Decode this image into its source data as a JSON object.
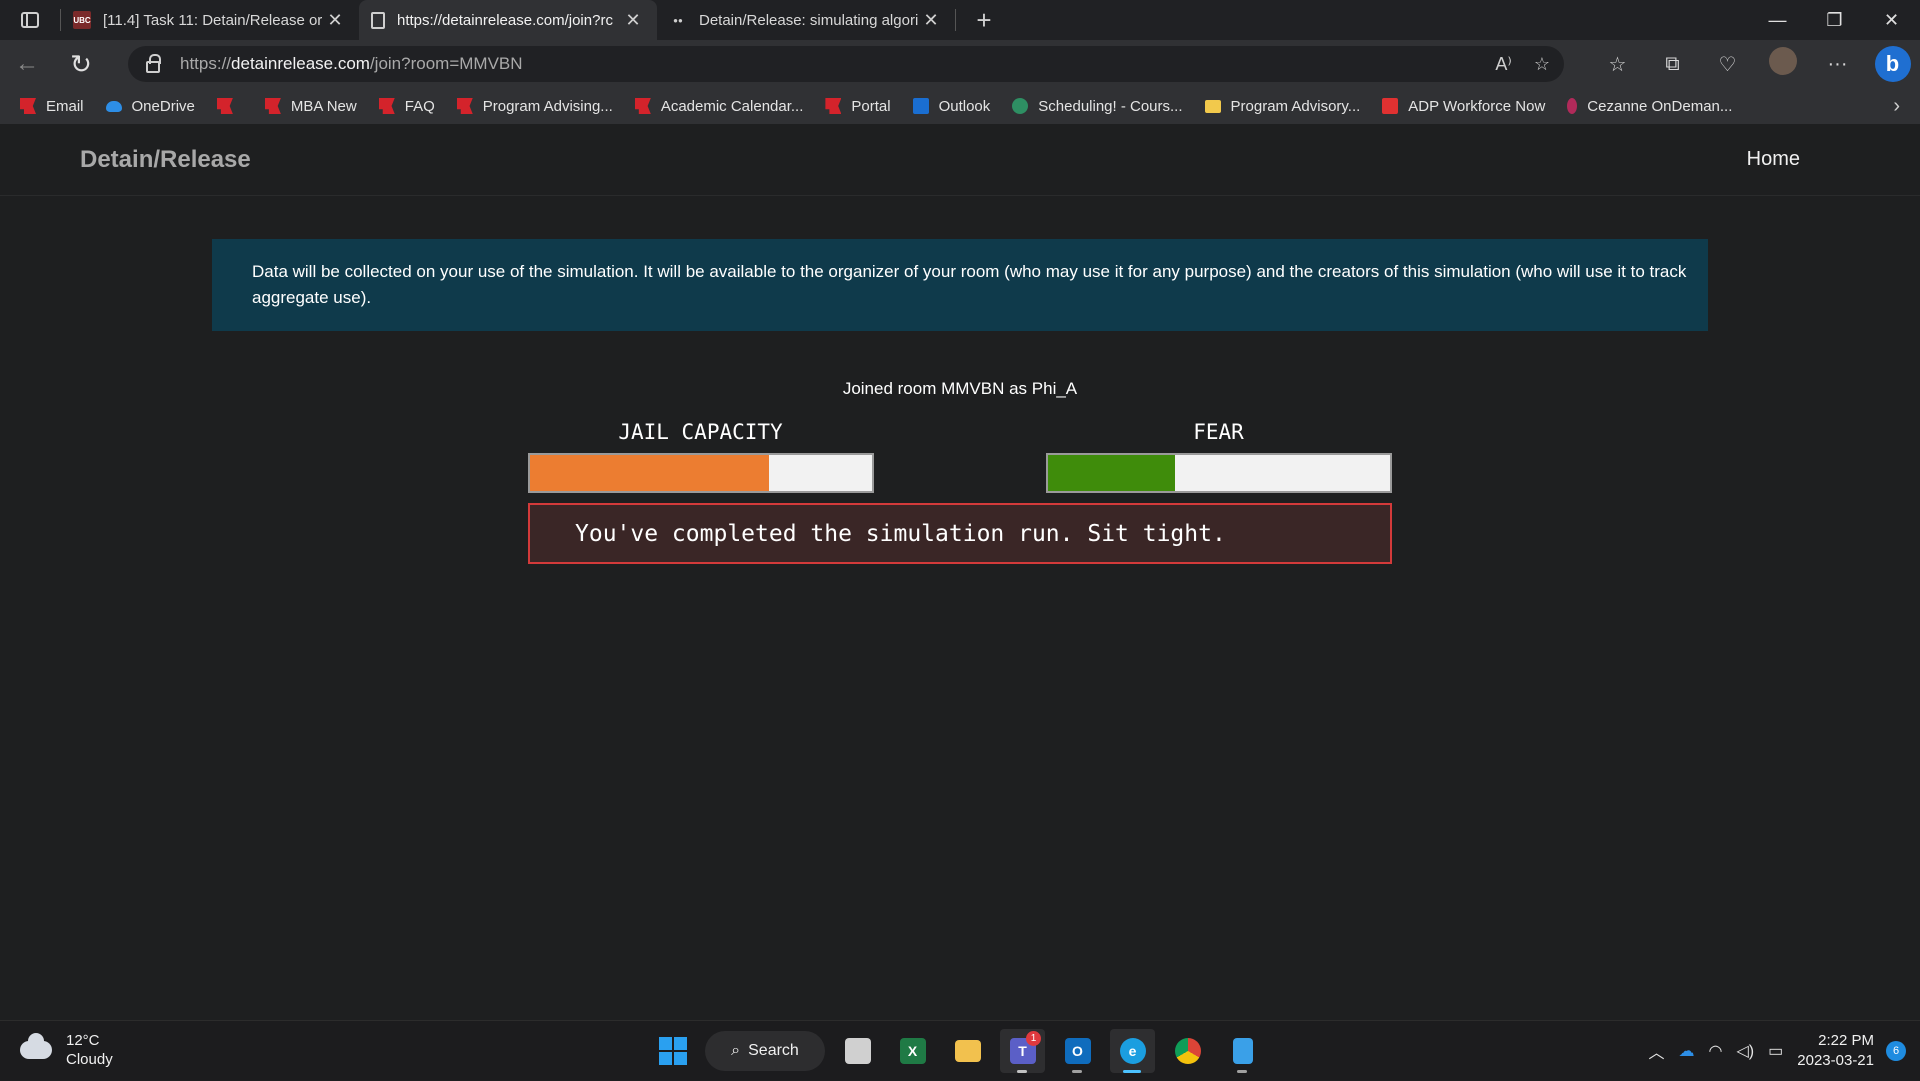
{
  "browser": {
    "tabs": [
      {
        "favicon": "UBC",
        "title": "[11.4] Task 11: Detain/Release or",
        "icon": "ubc-favicon-icon"
      },
      {
        "title": "https://detainrelease.com/join?rc",
        "icon": "page-icon"
      },
      {
        "title": "Detain/Release: simulating algori",
        "icon": "media-dots-icon"
      }
    ],
    "url_prefix": "https://",
    "url_domain": "detainrelease.com",
    "url_path": "/join?room=MMVBN",
    "read_aloud_label": "A⁾",
    "favorites": [
      {
        "label": "Email",
        "icon": "red-flag-icon"
      },
      {
        "label": "OneDrive",
        "icon": "onedrive-icon"
      },
      {
        "label": "",
        "icon": "red-flag-icon"
      },
      {
        "label": "MBA New",
        "icon": "red-flag-icon"
      },
      {
        "label": "FAQ",
        "icon": "red-flag-icon"
      },
      {
        "label": "Program Advising...",
        "icon": "red-flag-icon"
      },
      {
        "label": "Academic Calendar...",
        "icon": "red-flag-icon"
      },
      {
        "label": "Portal",
        "icon": "red-flag-icon"
      },
      {
        "label": "Outlook",
        "icon": "outlook-icon"
      },
      {
        "label": "Scheduling! - Cours...",
        "icon": "sharepoint-icon"
      },
      {
        "label": "Program Advisory...",
        "icon": "folder-icon"
      },
      {
        "label": "ADP Workforce Now",
        "icon": "adp-icon"
      },
      {
        "label": "Cezanne OnDeman...",
        "icon": "cezanne-icon"
      }
    ]
  },
  "site": {
    "brand": "Detain/Release",
    "nav_home": "Home",
    "notice": "Data will be collected on your use of the simulation. It will be available to the organizer of your room (who may use it for any purpose) and the creators of this simulation (who will use it to track aggregate use).",
    "joined_text": "Joined room MMVBN as Phi_A",
    "meters": [
      {
        "label": "JAIL CAPACITY",
        "level": 0.7,
        "color": "#ec7d31"
      },
      {
        "label": "FEAR",
        "level": 0.37,
        "color": "#3f8c0b"
      }
    ],
    "status_message": "You've completed the simulation run. Sit tight."
  },
  "taskbar": {
    "weather_temp": "12°C",
    "weather_desc": "Cloudy",
    "search_label": "Search",
    "teams_badge": "1",
    "time": "2:22 PM",
    "date": "2023-03-21",
    "notification_count": "6"
  }
}
